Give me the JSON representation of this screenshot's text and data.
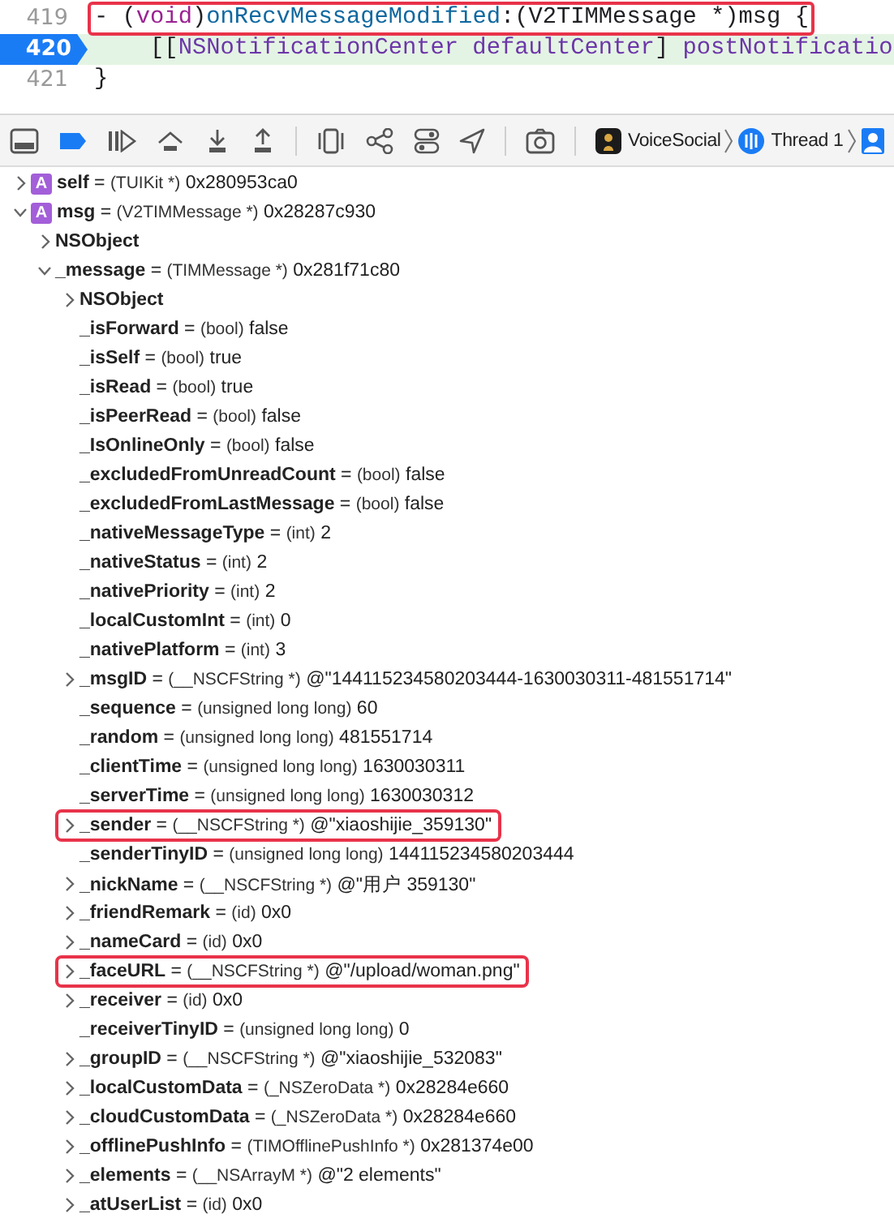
{
  "editor": {
    "lines": [
      {
        "number": "419",
        "current": false,
        "highlighted": true,
        "tokens": [
          {
            "text": "- (",
            "kind": "plain"
          },
          {
            "text": "void",
            "kind": "keyword"
          },
          {
            "text": ")",
            "kind": "plain"
          },
          {
            "text": "onRecvMessageModified",
            "kind": "method"
          },
          {
            "text": ":(V2TIMMessage *)msg {",
            "kind": "plain"
          }
        ]
      },
      {
        "number": "420",
        "current": true,
        "highlighted": false,
        "tokens": [
          {
            "text": "    [[",
            "kind": "plain"
          },
          {
            "text": "NSNotificationCenter defaultCenter",
            "kind": "class"
          },
          {
            "text": "] ",
            "kind": "plain"
          },
          {
            "text": "postNotificatio",
            "kind": "class"
          }
        ]
      },
      {
        "number": "421",
        "current": false,
        "highlighted": false,
        "tokens": [
          {
            "text": "}",
            "kind": "plain"
          }
        ]
      }
    ]
  },
  "debug_bar": {
    "breakpoints_active": true,
    "breadcrumbs": [
      {
        "kind": "app",
        "label": "VoiceSocial"
      },
      {
        "kind": "thread",
        "label": "Thread 1"
      },
      {
        "kind": "user"
      }
    ]
  },
  "variables": [
    {
      "badge": "A",
      "name": "self",
      "sep": "=",
      "type": "(TUIKit *)",
      "value": "0x280953ca0",
      "expanded": false
    },
    {
      "badge": "A",
      "name": "msg",
      "sep": "=",
      "type": "(V2TIMMessage *)",
      "value": "0x28287c930",
      "expanded": true,
      "children": [
        {
          "name": "NSObject",
          "expanded": false
        },
        {
          "name": "_message",
          "sep": "=",
          "type": "(TIMMessage *)",
          "value": "0x281f71c80",
          "expanded": true,
          "children": [
            {
              "name": "NSObject",
              "expanded": false
            },
            {
              "name": "_isForward",
              "sep": "=",
              "type": "(bool)",
              "value": "false"
            },
            {
              "name": "_isSelf",
              "sep": "=",
              "type": "(bool)",
              "value": "true"
            },
            {
              "name": "_isRead",
              "sep": "=",
              "type": "(bool)",
              "value": "true"
            },
            {
              "name": "_isPeerRead",
              "sep": "=",
              "type": "(bool)",
              "value": "false"
            },
            {
              "name": "_IsOnlineOnly",
              "sep": "=",
              "type": "(bool)",
              "value": "false"
            },
            {
              "name": "_excludedFromUnreadCount",
              "sep": "=",
              "type": "(bool)",
              "value": "false"
            },
            {
              "name": "_excludedFromLastMessage",
              "sep": "=",
              "type": "(bool)",
              "value": "false"
            },
            {
              "name": "_nativeMessageType",
              "sep": "=",
              "type": "(int)",
              "value": "2"
            },
            {
              "name": "_nativeStatus",
              "sep": "=",
              "type": "(int)",
              "value": "2"
            },
            {
              "name": "_nativePriority",
              "sep": "=",
              "type": "(int)",
              "value": "2"
            },
            {
              "name": "_localCustomInt",
              "sep": "=",
              "type": "(int)",
              "value": "0"
            },
            {
              "name": "_nativePlatform",
              "sep": "=",
              "type": "(int)",
              "value": "3"
            },
            {
              "name": "_msgID",
              "sep": "=",
              "type": "(__NSCFString *)",
              "value": "@\"144115234580203444-1630030311-481551714\"",
              "expanded": false
            },
            {
              "name": "_sequence",
              "sep": "=",
              "type": "(unsigned long long)",
              "value": "60"
            },
            {
              "name": "_random",
              "sep": "=",
              "type": "(unsigned long long)",
              "value": "481551714"
            },
            {
              "name": "_clientTime",
              "sep": "=",
              "type": "(unsigned long long)",
              "value": "1630030311"
            },
            {
              "name": "_serverTime",
              "sep": "=",
              "type": "(unsigned long long)",
              "value": "1630030312"
            },
            {
              "name": "_sender",
              "sep": "=",
              "type": "(__NSCFString *)",
              "value": "@\"xiaoshijie_359130\"",
              "expanded": false,
              "highlighted": true
            },
            {
              "name": "_senderTinyID",
              "sep": "=",
              "type": "(unsigned long long)",
              "value": "144115234580203444"
            },
            {
              "name": "_nickName",
              "sep": "=",
              "type": "(__NSCFString *)",
              "value": "@\"用户 359130\"",
              "expanded": false
            },
            {
              "name": "_friendRemark",
              "sep": "=",
              "type": "(id)",
              "value": "0x0",
              "expanded": false
            },
            {
              "name": "_nameCard",
              "sep": "=",
              "type": "(id)",
              "value": "0x0",
              "expanded": false
            },
            {
              "name": "_faceURL",
              "sep": "=",
              "type": "(__NSCFString *)",
              "value": "@\"/upload/woman.png\"",
              "expanded": false,
              "highlighted": true
            },
            {
              "name": "_receiver",
              "sep": "=",
              "type": "(id)",
              "value": "0x0",
              "expanded": false
            },
            {
              "name": "_receiverTinyID",
              "sep": "=",
              "type": "(unsigned long long)",
              "value": "0"
            },
            {
              "name": "_groupID",
              "sep": "=",
              "type": "(__NSCFString *)",
              "value": "@\"xiaoshijie_532083\"",
              "expanded": false
            },
            {
              "name": "_localCustomData",
              "sep": "=",
              "type": "(_NSZeroData *)",
              "value": "0x28284e660",
              "expanded": false
            },
            {
              "name": "_cloudCustomData",
              "sep": "=",
              "type": "(_NSZeroData *)",
              "value": "0x28284e660",
              "expanded": false
            },
            {
              "name": "_offlinePushInfo",
              "sep": "=",
              "type": "(TIMOfflinePushInfo *)",
              "value": "0x281374e00",
              "expanded": false
            },
            {
              "name": "_elements",
              "sep": "=",
              "type": "(__NSArrayM *)",
              "value": "@\"2 elements\"",
              "expanded": false
            },
            {
              "name": "_atUserList",
              "sep": "=",
              "type": "(id)",
              "value": "0x0",
              "expanded": false
            }
          ]
        }
      ]
    }
  ]
}
